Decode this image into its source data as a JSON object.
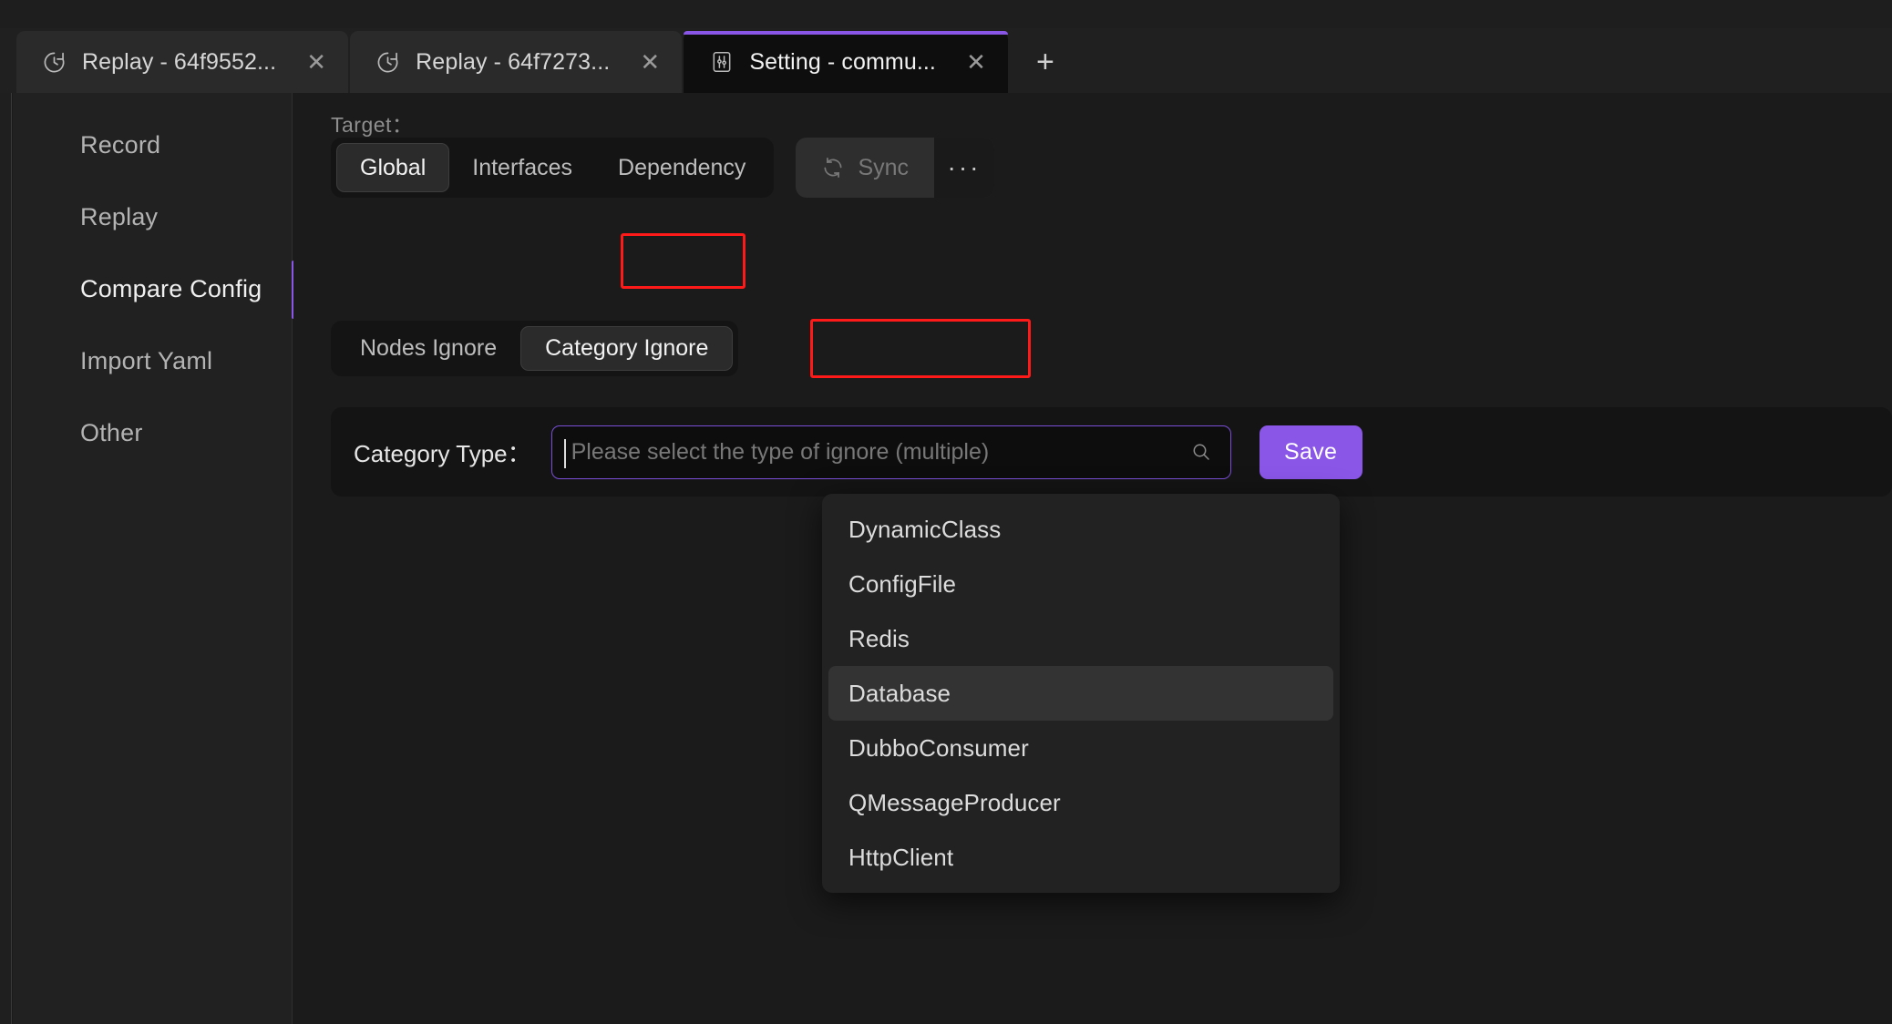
{
  "window": {
    "tabs": [
      {
        "icon": "history-clock-icon",
        "label": "Replay - 64f9552...",
        "close": "✕",
        "active": false
      },
      {
        "icon": "history-clock-icon",
        "label": "Replay - 64f7273...",
        "close": "✕",
        "active": false
      },
      {
        "icon": "settings-sliders-icon",
        "label": "Setting - commu...",
        "close": "✕",
        "active": true
      }
    ],
    "new_tab_label": "+"
  },
  "sidebar": {
    "items": [
      {
        "label": "Record",
        "active": false
      },
      {
        "label": "Replay",
        "active": false
      },
      {
        "label": "Compare Config",
        "active": true
      },
      {
        "label": "Import Yaml",
        "active": false
      },
      {
        "label": "Other",
        "active": false
      }
    ]
  },
  "main": {
    "target_label": "Target：",
    "target_tabs": [
      {
        "label": "Global",
        "selected": true
      },
      {
        "label": "Interfaces",
        "selected": false
      },
      {
        "label": "Dependency",
        "selected": false
      }
    ],
    "sync": {
      "label": "Sync",
      "icon": "refresh-icon",
      "disabled": true,
      "more_label": "···"
    },
    "subtabs": [
      {
        "label": "Nodes Ignore",
        "selected": false
      },
      {
        "label": "Category Ignore",
        "selected": true
      }
    ],
    "form": {
      "category_type_label": "Category Type：",
      "select_value": "",
      "select_placeholder": "Please select the type of ignore (multiple)",
      "search_icon": "search-icon",
      "save_label": "Save"
    },
    "dropdown": {
      "options": [
        {
          "label": "DynamicClass",
          "hovered": false
        },
        {
          "label": "ConfigFile",
          "hovered": false
        },
        {
          "label": "Redis",
          "hovered": false
        },
        {
          "label": "Database",
          "hovered": true
        },
        {
          "label": "DubboConsumer",
          "hovered": false
        },
        {
          "label": "QMessageProducer",
          "hovered": false
        },
        {
          "label": "HttpClient",
          "hovered": false
        }
      ]
    },
    "annotations": [
      {
        "name": "highlight-global",
        "color": "#ff1a1a"
      },
      {
        "name": "highlight-category-ignore",
        "color": "#ff1a1a"
      }
    ]
  },
  "colors": {
    "accent": "#8a56e8",
    "annotation": "#ff1a1a",
    "app_bg": "#1b1b1b",
    "panel_bg": "#141414",
    "tab_active_bg": "#0e0e0e"
  }
}
